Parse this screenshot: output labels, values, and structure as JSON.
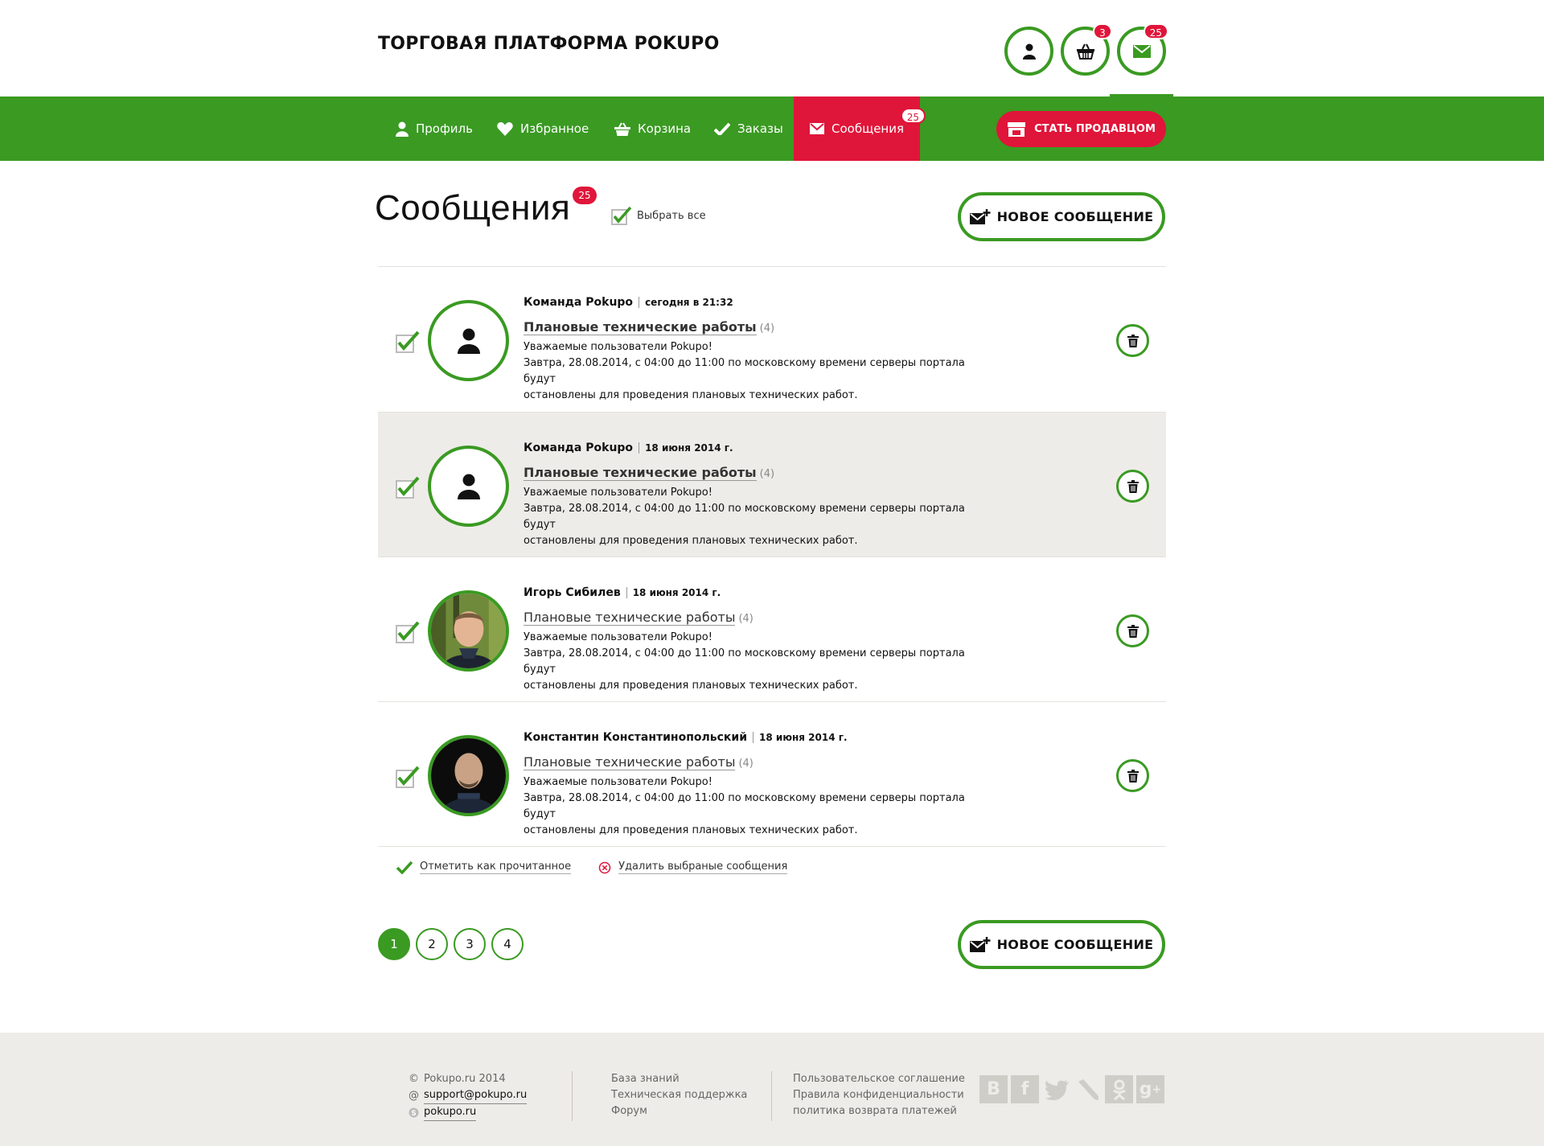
{
  "header": {
    "title": "ТОРГОВАЯ ПЛАТФОРМА POKUPO",
    "icons": [
      {
        "icon": "user-icon",
        "badge": ""
      },
      {
        "icon": "basket-icon",
        "badge": "3"
      },
      {
        "icon": "mail-icon",
        "badge": "25"
      }
    ]
  },
  "nav": {
    "items": [
      {
        "label": "Профиль",
        "icon": "user-icon"
      },
      {
        "label": "Избранное",
        "icon": "heart-icon"
      },
      {
        "label": "Корзина",
        "icon": "basket-icon"
      },
      {
        "label": "Заказы",
        "icon": "check-icon"
      },
      {
        "label": "Сообщения",
        "icon": "mail-icon",
        "badge": "25",
        "active": true
      }
    ],
    "seller_button": "СТАТЬ ПРОДАВЦОМ"
  },
  "page": {
    "title": "Сообщения",
    "badge": "25",
    "select_all": "Выбрать все",
    "new_message": "НОВОЕ СООБЩЕНИЕ"
  },
  "messages": [
    {
      "sender": "Команда Pokupo",
      "date": "сегодня в 21:32",
      "subject": "Плановые технические работы",
      "count": "(4)",
      "line1": "Уважаемые пользователи Pokupo!",
      "line2": "Завтра, 28.08.2014, с 04:00 до 11:00 по московскому времени серверы портала будут",
      "line3": "остановлены для проведения плановых технических работ."
    },
    {
      "sender": "Команда Pokupo",
      "date": "18 июня 2014 г.",
      "subject": "Плановые технические работы",
      "count": "(4)",
      "line1": "Уважаемые пользователи Pokupo!",
      "line2": "Завтра, 28.08.2014, с 04:00 до 11:00 по московскому времени серверы портала будут",
      "line3": "остановлены для проведения плановых технических работ."
    },
    {
      "sender": "Игорь Сибилев",
      "date": "18 июня 2014 г.",
      "subject": "Плановые технические работы",
      "count": "(4)",
      "line1": "Уважаемые пользователи Pokupo!",
      "line2": "Завтра, 28.08.2014, с 04:00 до 11:00 по московскому времени серверы портала будут",
      "line3": "остановлены для проведения плановых технических работ."
    },
    {
      "sender": "Константин Константинопольский",
      "date": "18 июня 2014 г.",
      "subject": "Плановые технические работы",
      "count": "(4)",
      "line1": "Уважаемые пользователи Pokupo!",
      "line2": "Завтра, 28.08.2014, с 04:00 до 11:00 по московскому времени серверы портала будут",
      "line3": "остановлены для проведения плановых технических работ."
    }
  ],
  "actions": {
    "mark_read": "Отметить как прочитанное",
    "delete_selected": "Удалить выбраные сообщения"
  },
  "pagination": {
    "pages": [
      "1",
      "2",
      "3",
      "4"
    ],
    "current": "1"
  },
  "footer": {
    "copyright": "Pokupo.ru 2014",
    "email": "support@pokupo.ru",
    "skype": "pokupo.ru",
    "links1": [
      "База знаний",
      "Техническая поддержка",
      "Форум"
    ],
    "links2": [
      "Пользовательское соглашение",
      "Правила конфиденциальности",
      "политика возврата платежей"
    ],
    "social": [
      "vk-icon",
      "facebook-icon",
      "twitter-icon",
      "livejournal-icon",
      "odnoklassniki-icon",
      "google-plus-icon"
    ]
  },
  "colors": {
    "accent_green": "#3a9a22",
    "accent_red": "#e0153a",
    "highlight_row": "#eeece8"
  }
}
